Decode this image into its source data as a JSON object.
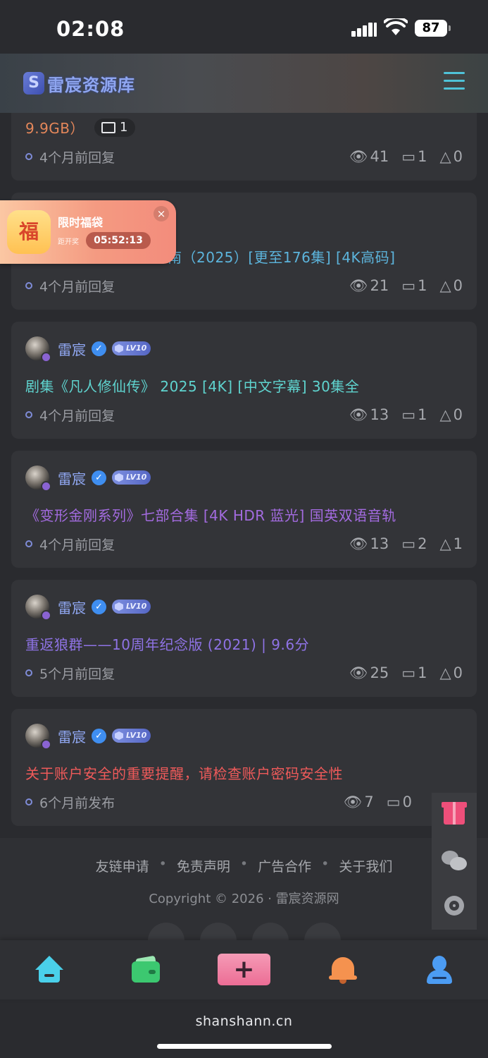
{
  "status_bar": {
    "time": "02:08",
    "battery": "87"
  },
  "header": {
    "logo_mark": "S",
    "logo_text": "雷宸资源库"
  },
  "fortune_bag": {
    "bag_char": "福",
    "title": "限时福袋",
    "subtitle": "距开奖",
    "countdown": "05:52:13",
    "close": "×"
  },
  "posts": [
    {
      "title": "9.9GB）",
      "image_count": "1",
      "meta": "4个月前回复",
      "views": "41",
      "comments": "1",
      "alerts": "0",
      "title_color": "#e4875a"
    },
    {
      "title": "南（2025）[更至176集] [4K高码]",
      "meta": "4个月前回复",
      "views": "21",
      "comments": "1",
      "alerts": "0",
      "title_color": "#5cb4dc"
    },
    {
      "author": "雷宸",
      "level": "LV10",
      "title": "剧集《凡人修仙传》 2025 [4K] [中文字幕] 30集全",
      "meta": "4个月前回复",
      "views": "13",
      "comments": "1",
      "alerts": "0",
      "title_color": "#5fd4cf"
    },
    {
      "author": "雷宸",
      "level": "LV10",
      "title": "《变形金刚系列》七部合集 [4K HDR 蓝光] 国英双语音轨",
      "meta": "4个月前回复",
      "views": "13",
      "comments": "2",
      "alerts": "1",
      "title_color": "#a36be0"
    },
    {
      "author": "雷宸",
      "level": "LV10",
      "title": "重返狼群——10周年纪念版 (2021) | 9.6分",
      "meta": "5个月前回复",
      "views": "25",
      "comments": "1",
      "alerts": "0",
      "title_color": "#8f73e6"
    },
    {
      "author": "雷宸",
      "level": "LV10",
      "title": "关于账户安全的重要提醒，请检查账户密码安全性",
      "meta": "6个月前发布",
      "views": "7",
      "comments": "0",
      "title_color": "#ef5a5a"
    }
  ],
  "footer": {
    "links": [
      "友链申请",
      "免责声明",
      "广告合作",
      "关于我们"
    ],
    "separator": "•",
    "copyright": "Copyright © 2026 · 雷宸资源网"
  },
  "side_tools": [
    "gift-icon",
    "wechat-icon",
    "settings-icon"
  ],
  "tabbar": [
    "home-icon",
    "wallet-icon",
    "add-icon",
    "bell-icon",
    "user-icon"
  ],
  "browser": {
    "url": "shanshann.cn"
  },
  "icons": {
    "views": "👁",
    "comments": "💬",
    "alerts": "△",
    "image": "🖼",
    "verified": "✓",
    "plus": "+"
  }
}
